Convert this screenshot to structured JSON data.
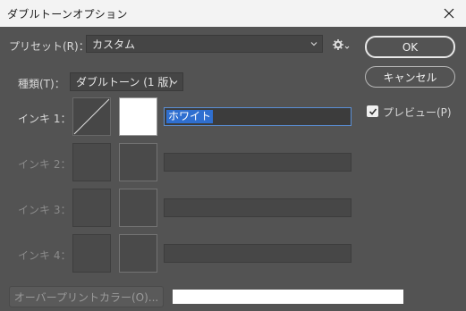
{
  "window": {
    "title": "ダブルトーンオプション"
  },
  "preset": {
    "label": "プリセット(R)：",
    "value": "カスタム"
  },
  "buttons": {
    "ok": "OK",
    "cancel": "キャンセル"
  },
  "preview": {
    "label": "プレビュー(P)",
    "checked": true
  },
  "type": {
    "label": "種類(T)：",
    "value": "ダブルトーン (1 版)"
  },
  "inks": [
    {
      "label": "インキ 1：",
      "name": "ホワイト",
      "enabled": true
    },
    {
      "label": "インキ 2：",
      "name": "",
      "enabled": false
    },
    {
      "label": "インキ 3：",
      "name": "",
      "enabled": false
    },
    {
      "label": "インキ 4：",
      "name": "",
      "enabled": false
    }
  ],
  "overprint": {
    "label": "オーバープリントカラー(O)..."
  },
  "colors": {
    "background": "#535353",
    "selection": "#2f6fd0",
    "field_focus": "#5a8fd6"
  },
  "icons": [
    "close-icon",
    "chevron-down-icon",
    "gear-icon",
    "checkmark-icon",
    "curve-diagonal-icon"
  ]
}
